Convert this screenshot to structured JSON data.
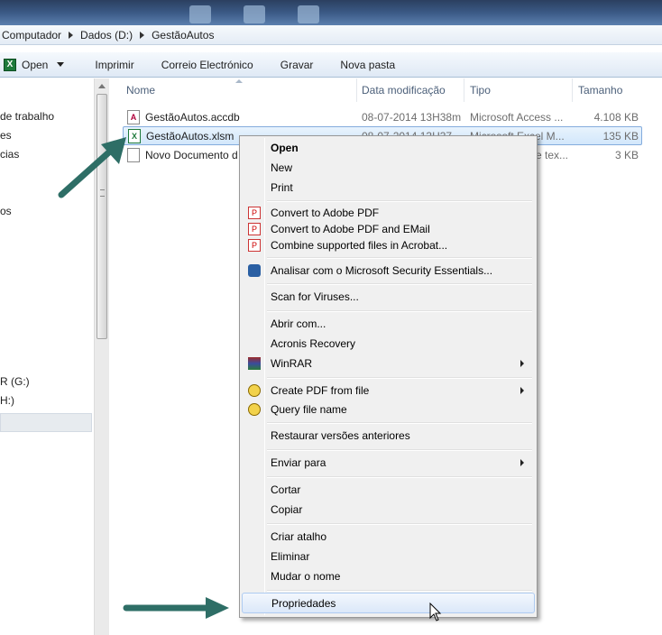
{
  "breadcrumb": [
    "Computador",
    "Dados (D:)",
    "GestãoAutos"
  ],
  "toolbar": {
    "open": "Open",
    "print": "Imprimir",
    "email": "Correio Electrónico",
    "burn": "Gravar",
    "new_folder": "Nova pasta"
  },
  "nav": {
    "items": [
      "de trabalho",
      "es",
      "cias",
      "os",
      "R (G:)",
      "H:)"
    ]
  },
  "columns": {
    "name": "Nome",
    "date": "Data modificação",
    "type": "Tipo",
    "size": "Tamanho"
  },
  "files": [
    {
      "name": "GestãoAutos.accdb",
      "date": "08-07-2014 13H38m",
      "type": "Microsoft Access ...",
      "size": "4.108 KB"
    },
    {
      "name": "GestãoAutos.xlsm",
      "date": "08-07-2014 13H37",
      "type": "Microsoft Excel M...",
      "size": "135 KB"
    },
    {
      "name": "Novo Documento d",
      "date": "",
      "type": "e tex...",
      "size": "3 KB"
    }
  ],
  "menu": {
    "open": "Open",
    "new": "New",
    "print": "Print",
    "convert_pdf": "Convert to Adobe PDF",
    "convert_pdf_email": "Convert to Adobe PDF and EMail",
    "combine_acrobat": "Combine supported files in Acrobat...",
    "mse_scan": "Analisar com o Microsoft Security Essentials...",
    "scan_viruses": "Scan for Viruses...",
    "open_with": "Abrir com...",
    "acronis": "Acronis Recovery",
    "winrar": "WinRAR",
    "create_pdf": "Create PDF from file",
    "query_name": "Query file name",
    "restore_versions": "Restaurar versões anteriores",
    "send_to": "Enviar para",
    "cut": "Cortar",
    "copy": "Copiar",
    "create_shortcut": "Criar atalho",
    "delete": "Eliminar",
    "rename": "Mudar o nome",
    "properties": "Propriedades"
  },
  "colors": {
    "arrow": "#2e6e66",
    "selection": "#d2e7fb",
    "menu_bg": "#f0f0f0"
  }
}
